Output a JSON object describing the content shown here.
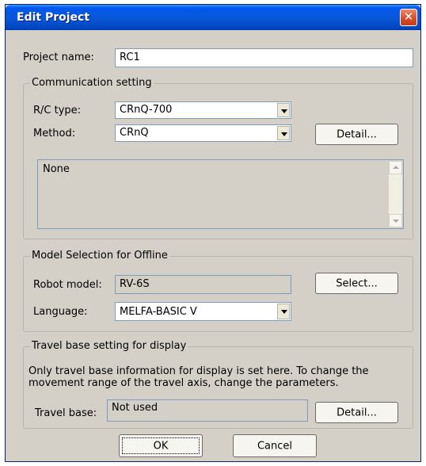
{
  "window": {
    "title": "Edit Project",
    "close_glyph": "✕"
  },
  "project": {
    "label": "Project name:",
    "value": "RC1"
  },
  "communication": {
    "legend": "Communication setting",
    "rc_type": {
      "label": "R/C type:",
      "value": "CRnQ-700"
    },
    "method": {
      "label": "Method:",
      "value": "CRnQ"
    },
    "detail_button": "Detail...",
    "info_text": "None"
  },
  "model": {
    "legend": "Model Selection for Offline",
    "robot": {
      "label": "Robot model:",
      "value": "RV-6S"
    },
    "select_button": "Select...",
    "language": {
      "label": "Language:",
      "value": "MELFA-BASIC V"
    }
  },
  "travel": {
    "legend": "Travel base setting for display",
    "description_line1": "Only travel base information for display is set here. To change the",
    "description_line2": "movement range of the travel axis, change the parameters.",
    "label": "Travel base:",
    "value": "Not used",
    "detail_button": "Detail..."
  },
  "footer": {
    "ok": "OK",
    "cancel": "Cancel"
  }
}
